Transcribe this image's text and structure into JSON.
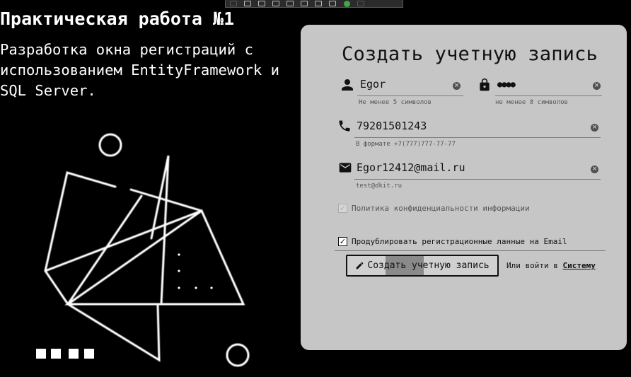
{
  "toolbar": {
    "icons": [
      "grip-icon",
      "select-element-icon",
      "display-layout-icon",
      "pointer-icon",
      "layout-adorner-icon",
      "track-focus-icon",
      "hot-reload-icon",
      "accessibility-icon",
      "binding-check-icon",
      "collapse-icon"
    ]
  },
  "heading": {
    "title": "Практическая работа №1",
    "subtitle": "Разработка окна регистраций с использованием EntityFramework и SQL Server."
  },
  "form": {
    "title": "Создать учетную запись",
    "username": {
      "value": "Egor",
      "hint": "Не менее 5 символов",
      "icon": "person-icon"
    },
    "password": {
      "value": "●●●●",
      "hint": "не менее 8 символов",
      "icon": "lock-icon"
    },
    "phone": {
      "value": "79201501243",
      "hint": "В формате +7(777)777-77-77",
      "icon": "phone-icon"
    },
    "email": {
      "value": "Egor12412@mail.ru",
      "hint": "test@dkit.ru",
      "icon": "mail-icon"
    },
    "privacy": {
      "label": "Политика конфиденциальности информации",
      "checked": true,
      "enabled": false
    },
    "duplicate": {
      "label": "Продублировать регистрационные ланные на Email",
      "checked": true
    },
    "submit_label": "Создать учетную запись",
    "login_prefix": "Или войти в",
    "login_link": "Систему"
  },
  "colors": {
    "background": "#000000",
    "panel": "#c6c6c6",
    "text": "#111111",
    "art": "#ffffff"
  }
}
